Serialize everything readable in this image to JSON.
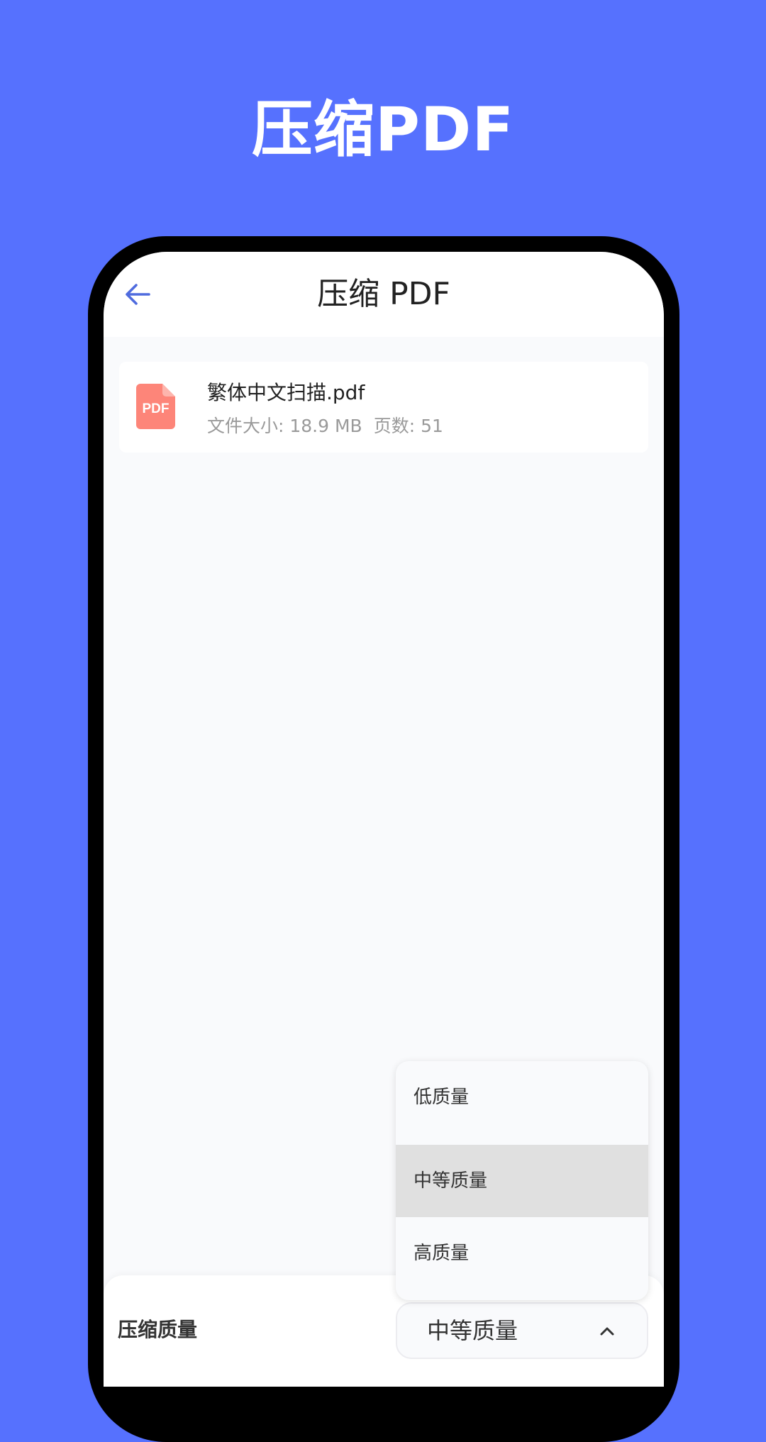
{
  "promo": {
    "title": "压缩PDF"
  },
  "header": {
    "title": "压缩 PDF",
    "back_icon": "arrow-left-icon"
  },
  "file": {
    "icon": "pdf-file-icon",
    "icon_text": "PDF",
    "name": "繁体中文扫描.pdf",
    "size": "文件大小: 18.9 MB",
    "pages": "页数: 51"
  },
  "quality": {
    "label": "压缩质量",
    "selected_value": "中等质量",
    "options": [
      {
        "label": "低质量"
      },
      {
        "label": "中等质量"
      },
      {
        "label": "高质量"
      }
    ],
    "dropdown_icon": "chevron-up-icon"
  },
  "colors": {
    "background": "#5671fe",
    "accent": "#4f6bde",
    "pdf_icon": "#fd8579",
    "selected_option": "#e0e0e0"
  }
}
